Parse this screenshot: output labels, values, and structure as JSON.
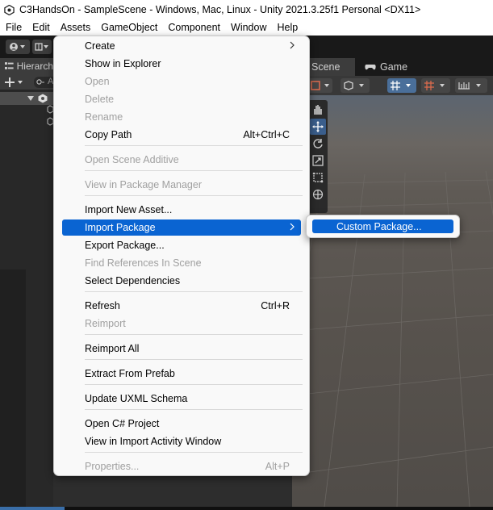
{
  "window": {
    "title": "C3HandsOn - SampleScene - Windows, Mac, Linux - Unity 2021.3.25f1 Personal <DX11>"
  },
  "menubar": {
    "items": [
      "File",
      "Edit",
      "Assets",
      "GameObject",
      "Component",
      "Window",
      "Help"
    ]
  },
  "hierarchy": {
    "tab_label": "Hierarch",
    "search_text": "A"
  },
  "scene": {
    "tab_scene": "Scene",
    "tab_game": "Game"
  },
  "context_menu": {
    "items": [
      {
        "label": "Create",
        "shortcut": "",
        "submenu": true,
        "disabled": false
      },
      {
        "label": "Show in Explorer",
        "shortcut": "",
        "disabled": false
      },
      {
        "label": "Open",
        "shortcut": "",
        "disabled": true
      },
      {
        "label": "Delete",
        "shortcut": "",
        "disabled": true
      },
      {
        "label": "Rename",
        "shortcut": "",
        "disabled": true
      },
      {
        "label": "Copy Path",
        "shortcut": "Alt+Ctrl+C",
        "disabled": false
      },
      {
        "label": "Open Scene Additive",
        "shortcut": "",
        "disabled": true
      },
      {
        "label": "View in Package Manager",
        "shortcut": "",
        "disabled": true
      },
      {
        "label": "Import New Asset...",
        "shortcut": "",
        "disabled": false
      },
      {
        "label": "Import Package",
        "shortcut": "",
        "submenu": true,
        "highlighted": true,
        "disabled": false
      },
      {
        "label": "Export Package...",
        "shortcut": "",
        "disabled": false
      },
      {
        "label": "Find References In Scene",
        "shortcut": "",
        "disabled": true
      },
      {
        "label": "Select Dependencies",
        "shortcut": "",
        "disabled": false
      },
      {
        "label": "Refresh",
        "shortcut": "Ctrl+R",
        "disabled": false
      },
      {
        "label": "Reimport",
        "shortcut": "",
        "disabled": true
      },
      {
        "label": "Reimport All",
        "shortcut": "",
        "disabled": false
      },
      {
        "label": "Extract From Prefab",
        "shortcut": "",
        "disabled": false
      },
      {
        "label": "Update UXML Schema",
        "shortcut": "",
        "disabled": false
      },
      {
        "label": "Open C# Project",
        "shortcut": "",
        "disabled": false
      },
      {
        "label": "View in Import Activity Window",
        "shortcut": "",
        "disabled": false
      },
      {
        "label": "Properties...",
        "shortcut": "Alt+P",
        "disabled": true
      }
    ]
  },
  "submenu": {
    "items": [
      {
        "label": "Custom Package...",
        "highlighted": true
      }
    ]
  },
  "colors": {
    "highlight": "#0a64d2",
    "menu_bg": "#f9f9f9",
    "disabled_text": "#a0a0a0",
    "editor_dark": "#191919",
    "panel": "#282828"
  }
}
